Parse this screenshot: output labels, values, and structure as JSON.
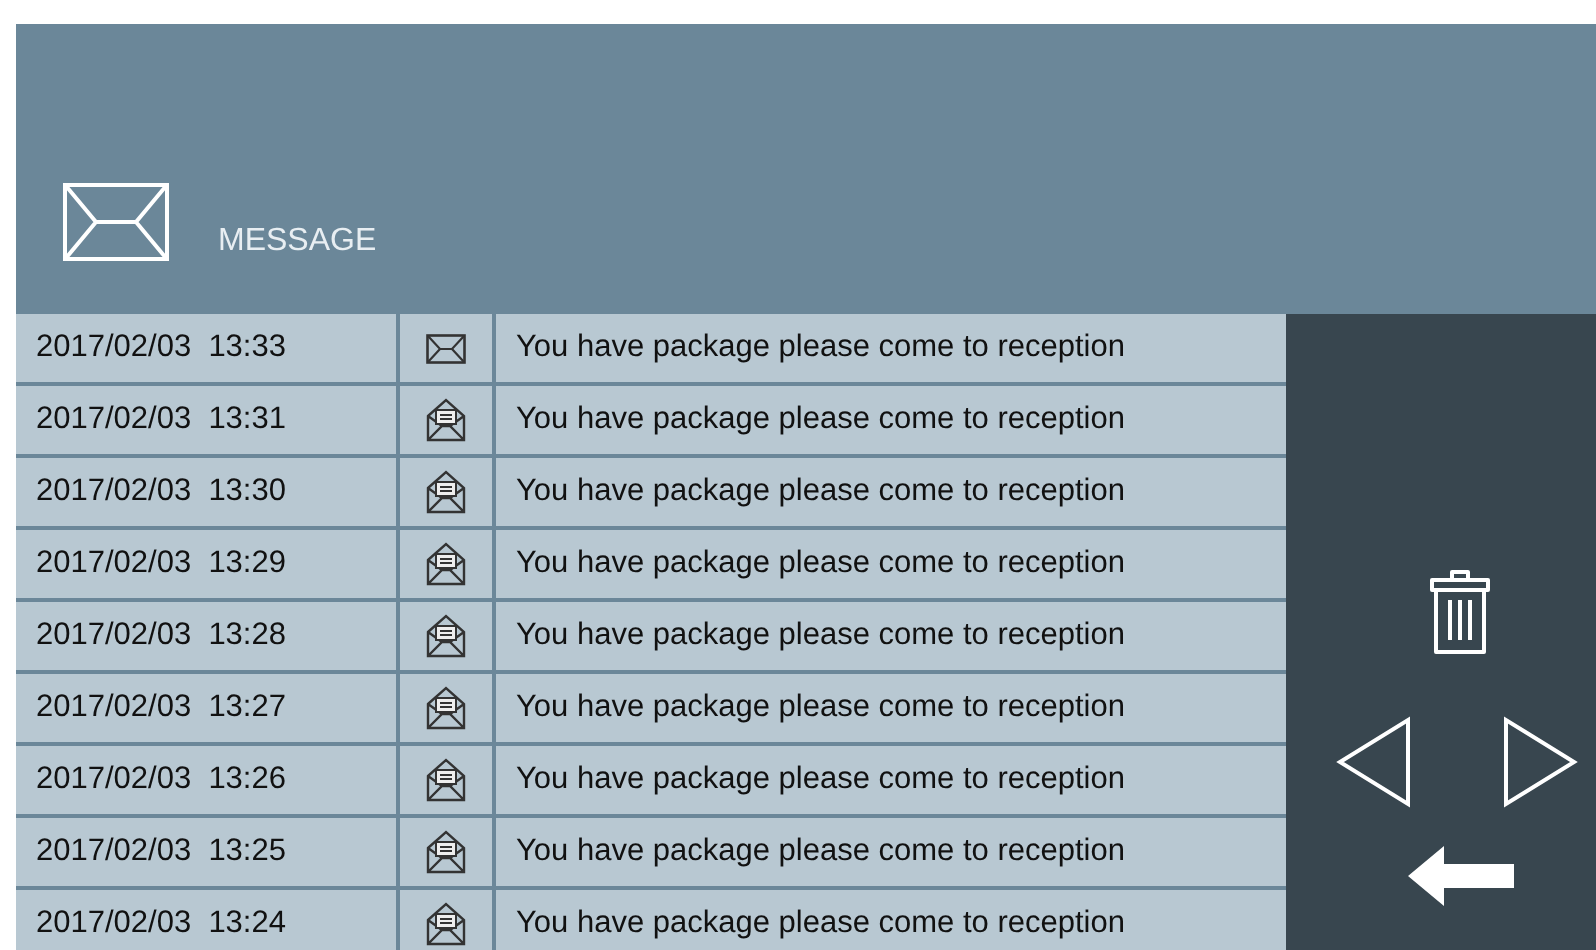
{
  "header": {
    "title": "MESSAGE"
  },
  "messages": [
    {
      "time": "2017/02/03  13:33",
      "read": false,
      "text": "You have package please come to reception"
    },
    {
      "time": "2017/02/03  13:31",
      "read": true,
      "text": "You have package please come to reception"
    },
    {
      "time": "2017/02/03  13:30",
      "read": true,
      "text": "You have package please come to reception"
    },
    {
      "time": "2017/02/03  13:29",
      "read": true,
      "text": "You have package please come to reception"
    },
    {
      "time": "2017/02/03  13:28",
      "read": true,
      "text": "You have package please come to reception"
    },
    {
      "time": "2017/02/03  13:27",
      "read": true,
      "text": "You have package please come to reception"
    },
    {
      "time": "2017/02/03  13:26",
      "read": true,
      "text": "You have package please come to reception"
    },
    {
      "time": "2017/02/03  13:25",
      "read": true,
      "text": "You have package please come to reception"
    },
    {
      "time": "2017/02/03  13:24",
      "read": true,
      "text": "You have package please come to reception"
    }
  ]
}
